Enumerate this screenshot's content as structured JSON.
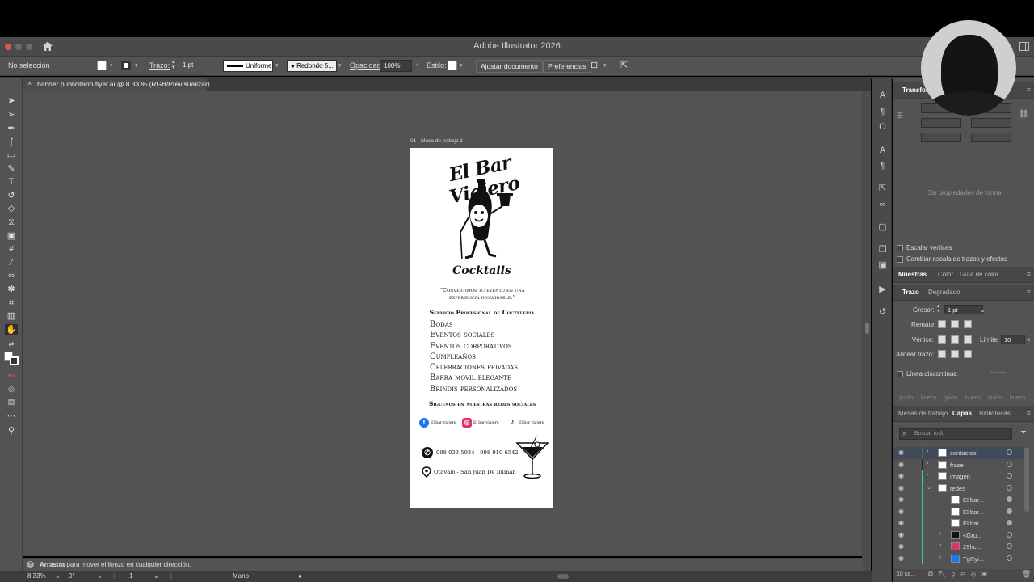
{
  "app": {
    "title": "Adobe Illustrator 2026"
  },
  "control_bar": {
    "selection": "No selección",
    "stroke_label": "Trazo:",
    "stroke_value": "1 pt",
    "profile": "Uniforme",
    "brush": "Redondo 5...",
    "opacity_label": "Opacidad:",
    "opacity_value": "100%",
    "style_label": "Estilo:",
    "fit_button": "Ajustar documento",
    "prefs_button": "Preferencias"
  },
  "document_tab": {
    "close": "×",
    "title": "banner publicitario flyer.ai @ 8.33 % (RGB/Previsualizar)"
  },
  "artboard": {
    "label": "01 - Mesa de trabajo 1",
    "title": "El Bar Viajero",
    "subtitle": "Cocktails",
    "quote": "“Convertimos tu evento en una experiencia inolvidable.”",
    "service_heading": "Servicio Profesional de Cocteleria",
    "services": [
      "Bodas",
      "Eventos sociales",
      "Eventos corporativos",
      "Cumpleaños",
      "Celebraciones privadas",
      "Barra movil elegante",
      "Brindis personalizados"
    ],
    "follow_heading": "Siguenos en nuestras redes sociales",
    "social": [
      {
        "icon": "facebook-icon",
        "color": "#1877f2",
        "label": "El bar viajero"
      },
      {
        "icon": "instagram-icon",
        "color": "#e1306c",
        "label": "El bar viajero"
      },
      {
        "icon": "tiktok-icon",
        "color": "#000000",
        "label": "El bar viajero"
      }
    ],
    "phone": "098 033 5934 - 098 910 6542",
    "address": "Otavalo - San Juan De Iluman"
  },
  "status": {
    "hint_bold": "Arrastra",
    "hint_rest": "para mover el lienzo en cualquier dirección.",
    "zoom": "8.33%",
    "rotation": "0°",
    "artboard_num": "1",
    "tool_name": "Mano"
  },
  "panels": {
    "transform_title": "Transfor",
    "no_shape": "Sin propiedades de forma",
    "scale_corners": "Escalar vértices",
    "scale_strokes": "Cambiar escala de trazos y efectos",
    "swatch_tabs": [
      "Muestras",
      "Color",
      "Guía de color"
    ],
    "stroke_tabs": [
      "Trazo",
      "Degradado"
    ],
    "weight_label": "Grosor:",
    "weight_value": "1 pt",
    "cap_label": "Remate:",
    "corner_label": "Vértice:",
    "limit_label": "Límite:",
    "limit_value": "10",
    "align_label": "Alinear trazo:",
    "dashed_label": "Línea discontinua",
    "dash_labels": [
      "guión",
      "hueco",
      "guión",
      "hueco",
      "guión",
      "hueco"
    ],
    "layer_tabs": [
      "Mesas de trabajo",
      "Capas",
      "Bibliotecas"
    ],
    "search_placeholder": "Buscar todo",
    "layers": [
      {
        "name": "contactos",
        "selected": true
      },
      {
        "name": "frase"
      },
      {
        "name": "imagen"
      },
      {
        "name": "redes"
      },
      {
        "name": "El bar..."
      },
      {
        "name": "El bar..."
      },
      {
        "name": "El bar..."
      },
      {
        "name": "<Gru..."
      },
      {
        "name": "29hc..."
      },
      {
        "name": "TgRyi..."
      }
    ],
    "layer_count": "10 ca..."
  }
}
